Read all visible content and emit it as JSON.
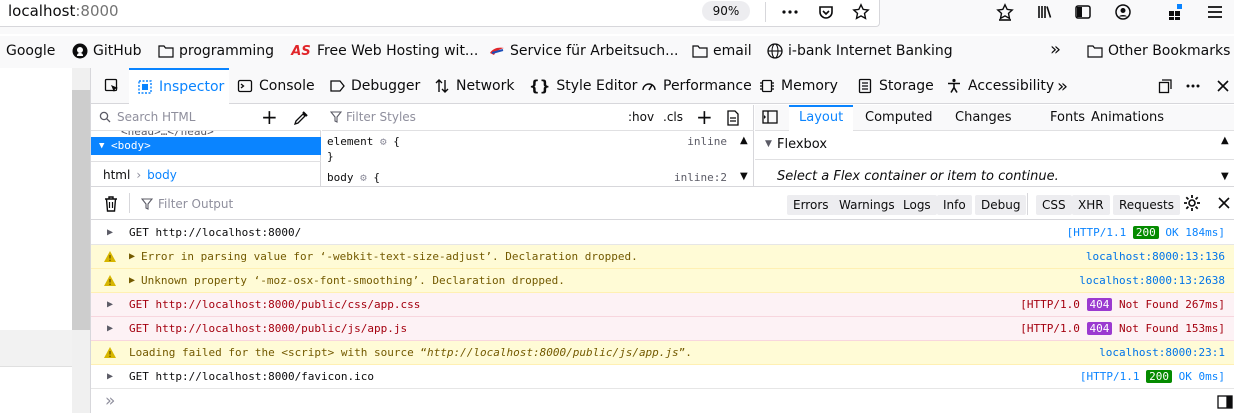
{
  "urlbar": {
    "host": "localhost",
    "port": ":8000",
    "zoom": "90%"
  },
  "bookmarks": [
    {
      "label": "Google",
      "icon": "google-icon"
    },
    {
      "label": "GitHub",
      "icon": "github-icon"
    },
    {
      "label": "programming",
      "icon": "folder-icon"
    },
    {
      "label": "Free Web Hosting wit...",
      "icon": "as-icon"
    },
    {
      "label": "Service für Arbeitsuch...",
      "icon": "agentur-icon"
    },
    {
      "label": "email",
      "icon": "folder-icon"
    },
    {
      "label": "i-bank Internet Banking",
      "icon": "globe-icon"
    },
    {
      "label": "Other Bookmarks",
      "icon": "folder-icon"
    }
  ],
  "devtools": {
    "tabs": [
      "Inspector",
      "Console",
      "Debugger",
      "Network",
      "Style Editor",
      "Performance",
      "Memory",
      "Storage",
      "Accessibility"
    ],
    "markup": {
      "search_placeholder": "Search HTML",
      "head_row": "<head>…</head>",
      "body_row": "<body>",
      "crumbs": [
        "html",
        "body"
      ]
    },
    "rules": {
      "filter_placeholder": "Filter Styles",
      "hov": ":hov",
      "cls": ".cls",
      "element_rule": "element",
      "element_source": "inline",
      "brace_open": "{",
      "brace_close": "}",
      "body_rule": "body",
      "body_source": "inline:2"
    },
    "layout": {
      "tabs": [
        "Layout",
        "Computed",
        "Changes",
        "Fonts",
        "Animations"
      ],
      "flexbox": "Flexbox",
      "hint": "Select a Flex container or item to continue."
    },
    "console": {
      "filter_placeholder": "Filter Output",
      "filters": [
        "Errors",
        "Warnings",
        "Logs",
        "Info",
        "Debug"
      ],
      "filters2": [
        "CSS",
        "XHR",
        "Requests"
      ],
      "rows": [
        {
          "type": "log",
          "msg": "GET http://localhost:8000/",
          "proto": "[HTTP/1.1",
          "status": "200",
          "status_text": "OK 184ms]"
        },
        {
          "type": "warn",
          "msg": "Error in parsing value for ‘-webkit-text-size-adjust’.  Declaration dropped.",
          "loc": "localhost:8000:13:136"
        },
        {
          "type": "warn",
          "msg": "Unknown property ‘-moz-osx-font-smoothing’.  Declaration dropped.",
          "loc": "localhost:8000:13:2638"
        },
        {
          "type": "err",
          "msg": "GET http://localhost:8000/public/css/app.css",
          "proto": "[HTTP/1.0",
          "status": "404",
          "status_text": "Not Found 267ms]"
        },
        {
          "type": "err",
          "msg": "GET http://localhost:8000/public/js/app.js",
          "proto": "[HTTP/1.0",
          "status": "404",
          "status_text": "Not Found 153ms]"
        },
        {
          "type": "warn",
          "msg_prefix": "Loading failed for the <script> with source “",
          "msg_url": "http://localhost:8000/public/js/app.js",
          "msg_suffix": "”.",
          "loc": "localhost:8000:23:1"
        },
        {
          "type": "log",
          "msg": "GET http://localhost:8000/favicon.ico",
          "proto": "[HTTP/1.1",
          "status": "200",
          "status_text": "OK 0ms]"
        }
      ],
      "input_prompt": "»"
    }
  },
  "colors": {
    "accent": "#0a84ff",
    "ok": "#058b00",
    "notfound": "#9b3ad0",
    "warn_bg": "#fffbd6",
    "err_bg": "#fdf2f5"
  }
}
